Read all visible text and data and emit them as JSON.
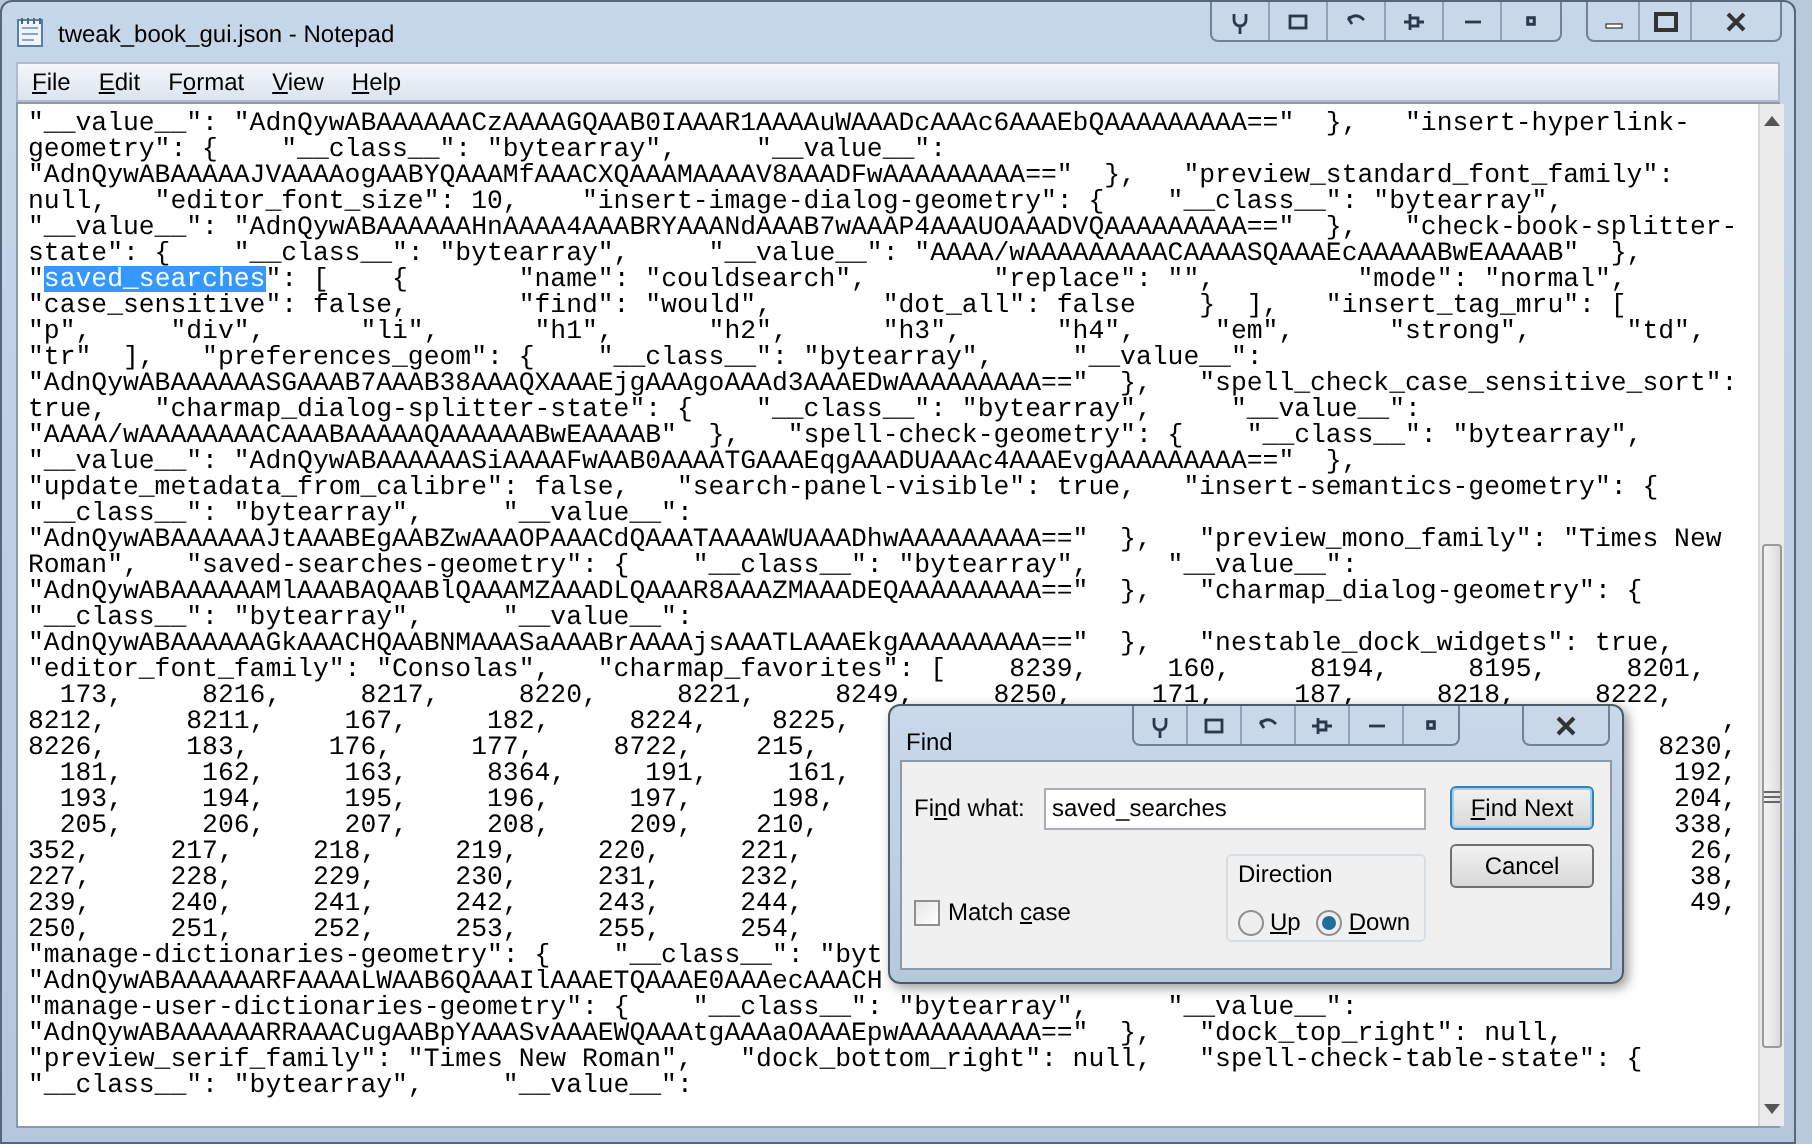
{
  "window": {
    "title": "tweak_book_gui.json - Notepad"
  },
  "menu": [
    {
      "key": "F",
      "after": "ile"
    },
    {
      "key": "E",
      "after": "dit"
    },
    {
      "before": "F",
      "key": "o",
      "after": "rmat"
    },
    {
      "key": "V",
      "after": "iew"
    },
    {
      "key": "H",
      "after": "elp"
    }
  ],
  "editor": {
    "lines": [
      {
        "text": "\"__value__\": \"AdnQywABAAAAAACzAAAAGQAAB0IAAAR1AAAAuWAAADcAAAc6AAAEbQAAAAAAAAA==\"  },   \"insert-hyperlink-"
      },
      {
        "text": "geometry\": {    \"__class__\": \"bytearray\",     \"__value__\":"
      },
      {
        "text": "\"AdnQywABAAAAAJVAAAAogAABYQAAAMfAAACXQAAAMAAAAV8AAADFwAAAAAAAAA==\"  },   \"preview_standard_font_family\":"
      },
      {
        "text": "null,   \"editor_font_size\": 10,    \"insert-image-dialog-geometry\": {    \"__class__\": \"bytearray\","
      },
      {
        "text": "\"__value__\": \"AdnQywABAAAAAAHnAAAA4AAABRYAAANdAAAB7wAAAP4AAAUOAAADVQAAAAAAAAA==\"  },   \"check-book-splitter-"
      },
      {
        "text": "state\": {    \"__class__\": \"bytearray\",     \"__value__\": \"AAAA/wAAAAAAAAACAAAASQAAAEcAAAAABwEAAAAB\"  },"
      },
      {
        "parts": [
          {
            "text": "\"",
            "selected": false
          },
          {
            "text": "saved_searches",
            "selected": true
          },
          {
            "text": "\": [    {       \"name\": \"couldsearch\",        \"replace\": \"\",         \"mode\": \"normal\",",
            "selected": false
          }
        ]
      },
      {
        "text": "\"case_sensitive\": false,       \"find\": \"would\",       \"dot_all\": false    }  ],   \"insert_tag_mru\": ["
      },
      {
        "text": "\"p\",     \"div\",      \"li\",      \"h1\",      \"h2\",      \"h3\",      \"h4\",     \"em\",      \"strong\",      \"td\","
      },
      {
        "text": "\"tr\"  ],   \"preferences_geom\": {    \"__class__\": \"bytearray\",     \"__value__\":"
      },
      {
        "text": "\"AdnQywABAAAAAASGAAAB7AAAB38AAAQXAAAEjgAAAgoAAAd3AAAEDwAAAAAAAAA==\"  },   \"spell_check_case_sensitive_sort\":"
      },
      {
        "text": "true,   \"charmap_dialog-splitter-state\": {    \"__class__\": \"bytearray\",     \"__value__\":"
      },
      {
        "text": "\"AAAA/wAAAAAAAACAAABAAAAAQAAAAAABwEAAAAB\"  },   \"spell-check-geometry\": {    \"__class__\": \"bytearray\","
      },
      {
        "text": "\"__value__\": \"AdnQywABAAAAAASiAAAAFwAAB0AAAATGAAAEqgAAADUAAAc4AAAEvgAAAAAAAAA==\"  },"
      },
      {
        "text": "\"update_metadata_from_calibre\": false,   \"search-panel-visible\": true,   \"insert-semantics-geometry\": {"
      },
      {
        "text": "\"__class__\": \"bytearray\",     \"__value__\":"
      },
      {
        "text": "\"AdnQywABAAAAAAJtAAABEgAABZwAAAOPAAACdQAAATAAAAWUAAADhwAAAAAAAAA==\"  },   \"preview_mono_family\": \"Times New"
      },
      {
        "text": "Roman\",   \"saved-searches-geometry\": {    \"__class__\": \"bytearray\",     \"__value__\":"
      },
      {
        "text": "\"AdnQywABAAAAAAMlAAABAQAABlQAAAMZAAADLQAAAR8AAAZMAAADEQAAAAAAAAA==\"  },   \"charmap_dialog-geometry\": {"
      },
      {
        "text": "\"__class__\": \"bytearray\",     \"__value__\":"
      },
      {
        "text": "\"AdnQywABAAAAAAGkAAACHQAABNMAAASaAAABrAAAAjsAAATLAAAEkgAAAAAAAAA==\"  },   \"nestable_dock_widgets\": true,"
      },
      {
        "text": "\"editor_font_family\": \"Consolas\",   \"charmap_favorites\": [    8239,     160,     8194,     8195,     8201,"
      },
      {
        "text": "  173,     8216,     8217,     8220,     8221,     8249,     8250,     171,     187,     8218,     8222,"
      },
      {
        "text": "8212,     8211,     167,     182,     8224,    8225,",
        "tail": ","
      },
      {
        "text": "8226,     183,     176,     177,     8722,    215,",
        "tail": "8230,"
      },
      {
        "text": "  181,     162,     163,     8364,     191,     161,",
        "tail": "192,"
      },
      {
        "text": "  193,     194,     195,     196,     197,     198,",
        "tail": "204,"
      },
      {
        "text": "  205,     206,     207,     208,     209,    210,",
        "tail": "338,"
      },
      {
        "text": "352,     217,     218,     219,     220,     221,",
        "tail": "26,"
      },
      {
        "text": "227,     228,     229,     230,     231,     232,",
        "tail": "38,"
      },
      {
        "text": "239,     240,     241,     242,     243,     244,",
        "tail": "49,"
      },
      {
        "text": "250,     251,     252,     253,     255,     254,"
      },
      {
        "text": "\"manage-dictionaries-geometry\": {    \"__class__\": \"byt"
      },
      {
        "text": "\"AdnQywABAAAAAARFAAAALWAAB6QAAAIlAAAETQAAAE0AAAecAAACH"
      },
      {
        "text": "\"manage-user-dictionaries-geometry\": {    \"__class__\": \"bytearray\",     \"__value__\":"
      },
      {
        "text": "\"AdnQywABAAAAAARRAAACugAABpYAAASvAAAEWQAAAtgAAAaOAAAEpwAAAAAAAAA==\"  },   \"dock_top_right\": null,"
      },
      {
        "text": "\"preview_serif_family\": \"Times New Roman\",   \"dock_bottom_right\": null,   \"spell-check-table-state\": {"
      },
      {
        "text": "\"__class__\": \"bytearray\",     \"__value__\":"
      }
    ]
  },
  "find_dialog": {
    "title": "Find",
    "find_what": {
      "label": {
        "before": "Fi",
        "key": "n",
        "after": "d what:"
      },
      "value": "saved_searches"
    },
    "match_case": {
      "label": {
        "before": "Match ",
        "key": "c",
        "after": "ase"
      },
      "checked": false
    },
    "direction": {
      "title": "Direction",
      "options": [
        {
          "label": {
            "key": "U",
            "after": "p"
          },
          "selected": false
        },
        {
          "label": {
            "key": "D",
            "after": "own"
          },
          "selected": true
        }
      ]
    },
    "buttons": [
      {
        "label": {
          "key": "F",
          "after": "ind Next"
        },
        "default": true
      },
      {
        "label": {
          "before": "Cancel"
        },
        "default": false
      }
    ]
  }
}
